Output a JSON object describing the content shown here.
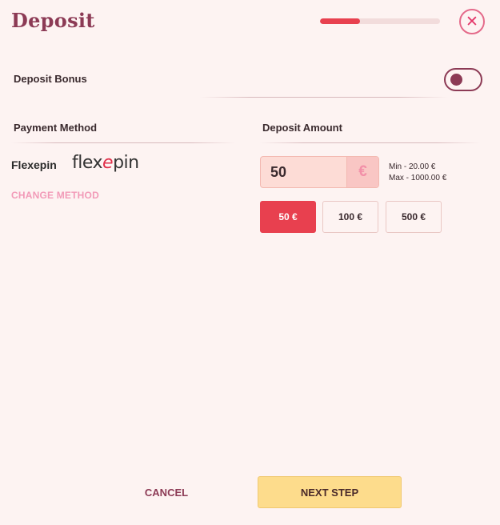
{
  "header": {
    "title": "Deposit",
    "progress_fraction": 0.33,
    "close_icon": "close-icon"
  },
  "bonus": {
    "label": "Deposit Bonus",
    "toggle_on": false
  },
  "payment_method": {
    "label": "Payment Method",
    "name": "Flexepin",
    "logo_text_before": "flex",
    "logo_text_accent": "e",
    "logo_text_after": "pin",
    "change_label": "CHANGE METHOD"
  },
  "deposit_amount": {
    "label": "Deposit Amount",
    "value": "50",
    "currency_symbol": "€",
    "min_text": "Min - 20.00 €",
    "max_text": "Max - 1000.00 €",
    "presets": [
      {
        "label": "50 €",
        "selected": true
      },
      {
        "label": "100 €",
        "selected": false
      },
      {
        "label": "500 €",
        "selected": false
      }
    ]
  },
  "footer": {
    "cancel_label": "CANCEL",
    "next_label": "NEXT STEP"
  },
  "colors": {
    "accent": "#e8404f",
    "brand": "#8c3a55",
    "link": "#f29ab8",
    "cta": "#fddc8c",
    "background": "#fdf3f2"
  }
}
